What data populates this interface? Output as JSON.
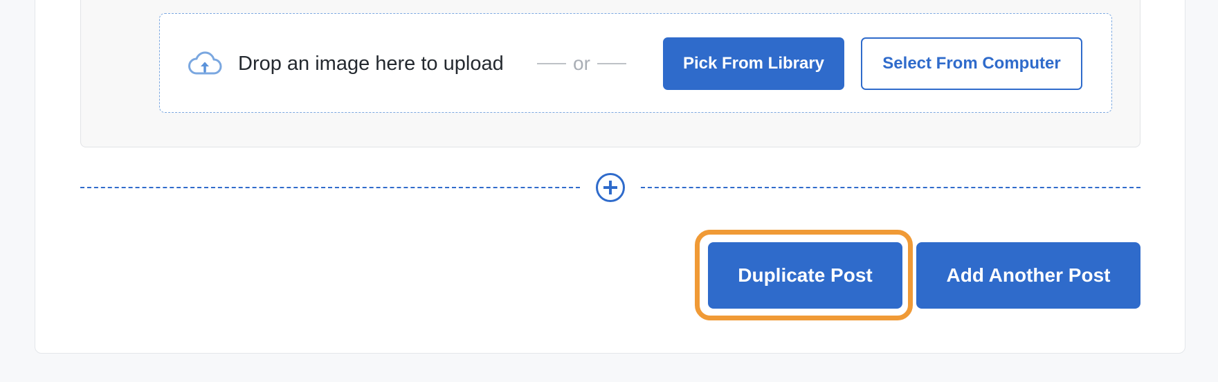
{
  "upload": {
    "icon": "cloud-upload-icon",
    "drop_text": "Drop an image here to upload",
    "or_text": "or",
    "pick_library_label": "Pick From Library",
    "select_computer_label": "Select From Computer"
  },
  "editor": {
    "add_block_icon": "plus-circle-icon"
  },
  "actions": {
    "duplicate_label": "Duplicate Post",
    "add_another_label": "Add Another Post"
  },
  "colors": {
    "accent": "#2f6bcb",
    "focus_ring": "#f09a36",
    "dropzone_border": "#7aa7e0"
  }
}
